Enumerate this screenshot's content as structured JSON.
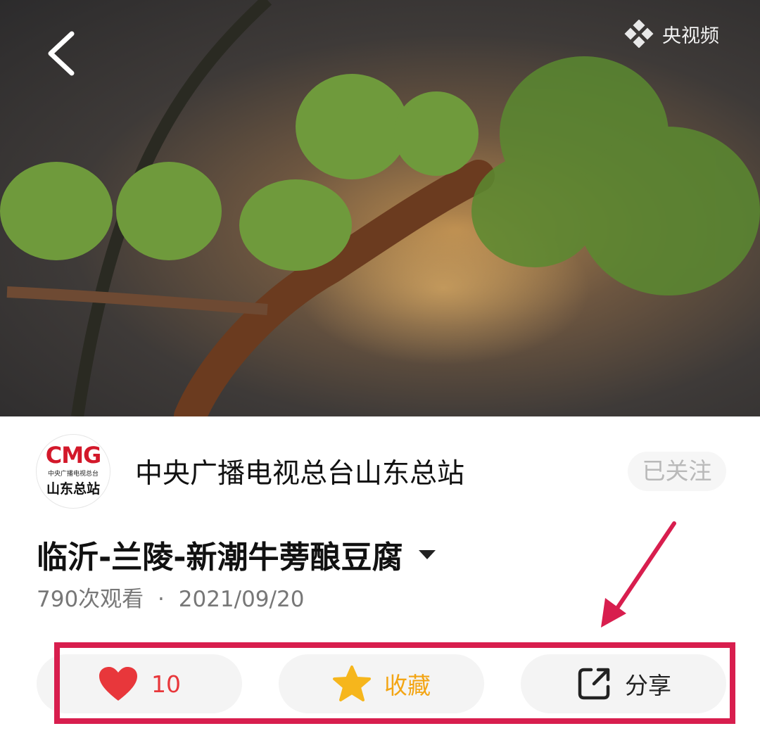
{
  "video": {
    "watermark_text": "央视频",
    "back_icon": "chevron-left-icon",
    "watermark_icon": "yangshipin-logo-icon"
  },
  "channel": {
    "avatar_logo_text": "CMG",
    "avatar_sub_text": "中央广播电视总台",
    "avatar_region_text": "山东总站",
    "name": "中央广播电视总台山东总站",
    "follow_label": "已关注"
  },
  "video_info": {
    "title": "临沂-兰陵-新潮牛蒡酿豆腐",
    "views": "790次观看",
    "separator": "·",
    "date": "2021/09/20"
  },
  "actions": {
    "like": {
      "icon": "heart-icon",
      "count": "10",
      "color": "#e8373b"
    },
    "favorite": {
      "icon": "star-icon",
      "label": "收藏",
      "color": "#f3a514"
    },
    "share": {
      "icon": "share-icon",
      "label": "分享",
      "color": "#222222"
    }
  },
  "annotation": {
    "highlight_color": "#d81e4e"
  }
}
